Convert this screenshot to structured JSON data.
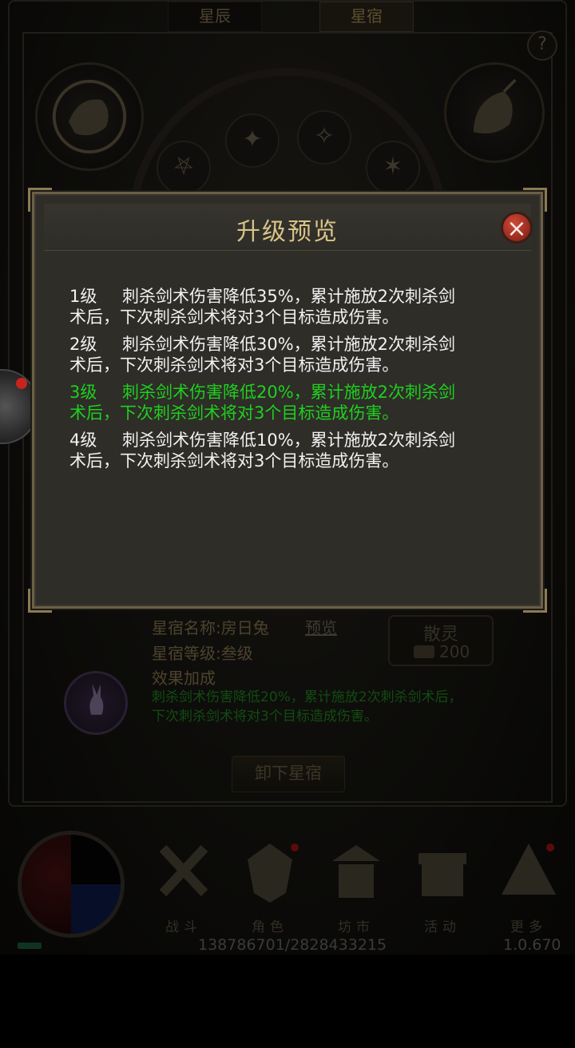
{
  "tabs": [
    "星辰",
    "星宿"
  ],
  "help_icon": "?",
  "info": {
    "name_label": "星宿名称:房日兔",
    "preview_link": "预览",
    "level_label": "星宿等级:叁级",
    "effect_title": "效果加成",
    "effect_line1": "刺杀剑术伤害降低20%，累计施放2次刺杀剑术后，",
    "effect_line2": "下次刺杀剑术将对3个目标造成伤害。"
  },
  "scatter": {
    "title": "散灵",
    "cost": "200"
  },
  "remove_button": "卸下星宿",
  "nav": [
    {
      "label": "战斗",
      "icon": "crossed-swords-icon",
      "badge": false
    },
    {
      "label": "角色",
      "icon": "character-icon",
      "badge": true
    },
    {
      "label": "坊市",
      "icon": "market-icon",
      "badge": false
    },
    {
      "label": "活动",
      "icon": "gift-icon",
      "badge": false
    },
    {
      "label": "更多",
      "icon": "more-icon",
      "badge": true
    }
  ],
  "status": {
    "exp": "138786701/2828433215",
    "version": "1.0.670"
  },
  "dialog": {
    "title": "升级预览",
    "close": "×",
    "levels": [
      {
        "name": "1级",
        "line1": "刺杀剑术伤害降低35%，累计施放2次刺杀剑",
        "line2": "术后，下次刺杀剑术将对3个目标造成伤害。",
        "current": false
      },
      {
        "name": "2级",
        "line1": "刺杀剑术伤害降低30%，累计施放2次刺杀剑",
        "line2": "术后，下次刺杀剑术将对3个目标造成伤害。",
        "current": false
      },
      {
        "name": "3级",
        "line1": "刺杀剑术伤害降低20%，累计施放2次刺杀剑",
        "line2": "术后，下次刺杀剑术将对3个目标造成伤害。",
        "current": true
      },
      {
        "name": "4级",
        "line1": "刺杀剑术伤害降低10%，累计施放2次刺杀剑",
        "line2": "术后，下次刺杀剑术将对3个目标造成伤害。",
        "current": false
      }
    ]
  },
  "colors": {
    "current_level": "#1fd01f",
    "title_gold": "#d8c487",
    "close_red": "#c0392b"
  }
}
